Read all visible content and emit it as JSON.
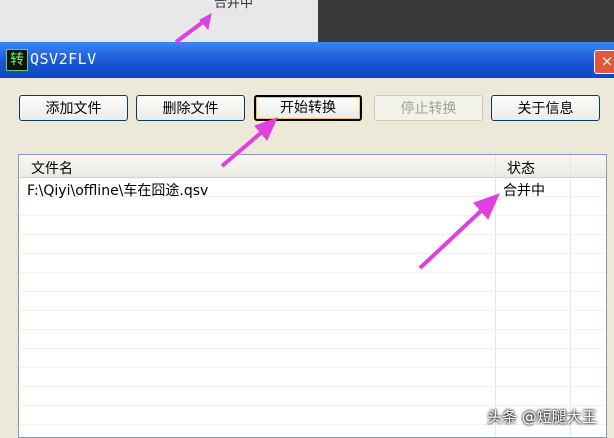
{
  "background": {
    "peek_text": "合并中"
  },
  "window": {
    "title": "QSV2FLV",
    "app_icon_glyph": "转",
    "close_glyph": "×"
  },
  "toolbar": {
    "add_file": "添加文件",
    "delete_file": "删除文件",
    "start_convert": "开始转换",
    "stop_convert": "停止转换",
    "about": "关于信息"
  },
  "file_list": {
    "columns": [
      "文件名",
      "状态"
    ],
    "rows": [
      {
        "filename": "F:\\Qiyi\\offline\\车在囧途.qsv",
        "status": "合并中"
      }
    ]
  },
  "watermark": "头条 @短腿大王",
  "colors": {
    "title_bar": "#1957d8",
    "annotation_arrow": "#e040e0"
  }
}
